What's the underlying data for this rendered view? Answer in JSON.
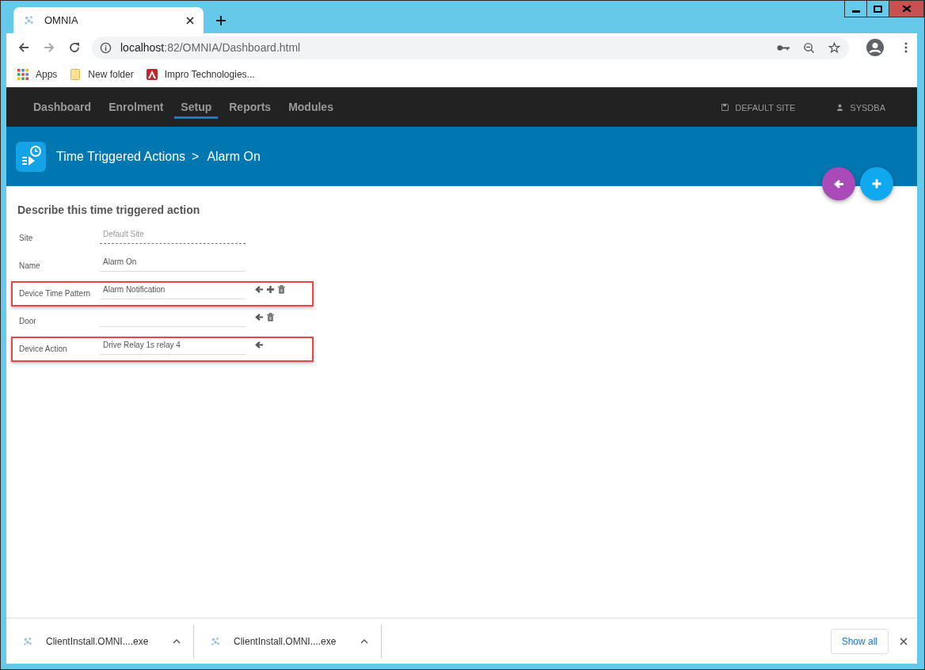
{
  "browser": {
    "tab": {
      "title": "OMNIA"
    },
    "address": {
      "host": "localhost",
      "path": ":82/OMNIA/Dashboard.html"
    },
    "bookmarks": [
      {
        "kind": "apps",
        "label": "Apps"
      },
      {
        "kind": "folder",
        "label": "New folder"
      },
      {
        "kind": "site",
        "label": "Impro Technologies..."
      }
    ]
  },
  "nav": {
    "items": [
      {
        "label": "Dashboard",
        "selected": false
      },
      {
        "label": "Enrolment",
        "selected": false
      },
      {
        "label": "Setup",
        "selected": true
      },
      {
        "label": "Reports",
        "selected": false
      },
      {
        "label": "Modules",
        "selected": false
      }
    ],
    "right": [
      {
        "kind": "site",
        "label": "DEFAULT SITE"
      },
      {
        "kind": "user",
        "label": "SYSDBA"
      }
    ]
  },
  "header": {
    "breadcrumb": "Time Triggered Actions",
    "separator": ">",
    "current": "Alarm On"
  },
  "form": {
    "title": "Describe this time triggered action",
    "rows": [
      {
        "label": "Site",
        "placeholder": "Default Site",
        "readonly": true,
        "highlighted": false,
        "actions": []
      },
      {
        "label": "Name",
        "value": "Alarm On",
        "readonly": false,
        "highlighted": false,
        "actions": []
      },
      {
        "label": "Device Time Pattern",
        "value": "Alarm Notification",
        "readonly": false,
        "highlighted": true,
        "actions": [
          {
            "kind": "select"
          },
          {
            "kind": "add"
          },
          {
            "kind": "delete"
          }
        ]
      },
      {
        "label": "Door",
        "readonly": false,
        "highlighted": false,
        "actions": [
          {
            "kind": "select"
          },
          {
            "kind": "delete"
          }
        ]
      },
      {
        "label": "Device Action",
        "value": "Drive Relay 1s relay 4",
        "readonly": false,
        "highlighted": true,
        "actions": [
          {
            "kind": "select"
          }
        ]
      }
    ]
  },
  "downloads": {
    "items": [
      {
        "name": "ClientInstall.OMNI....exe"
      },
      {
        "name": "ClientInstall.OMNI....exe"
      }
    ],
    "show_all": "Show all"
  }
}
